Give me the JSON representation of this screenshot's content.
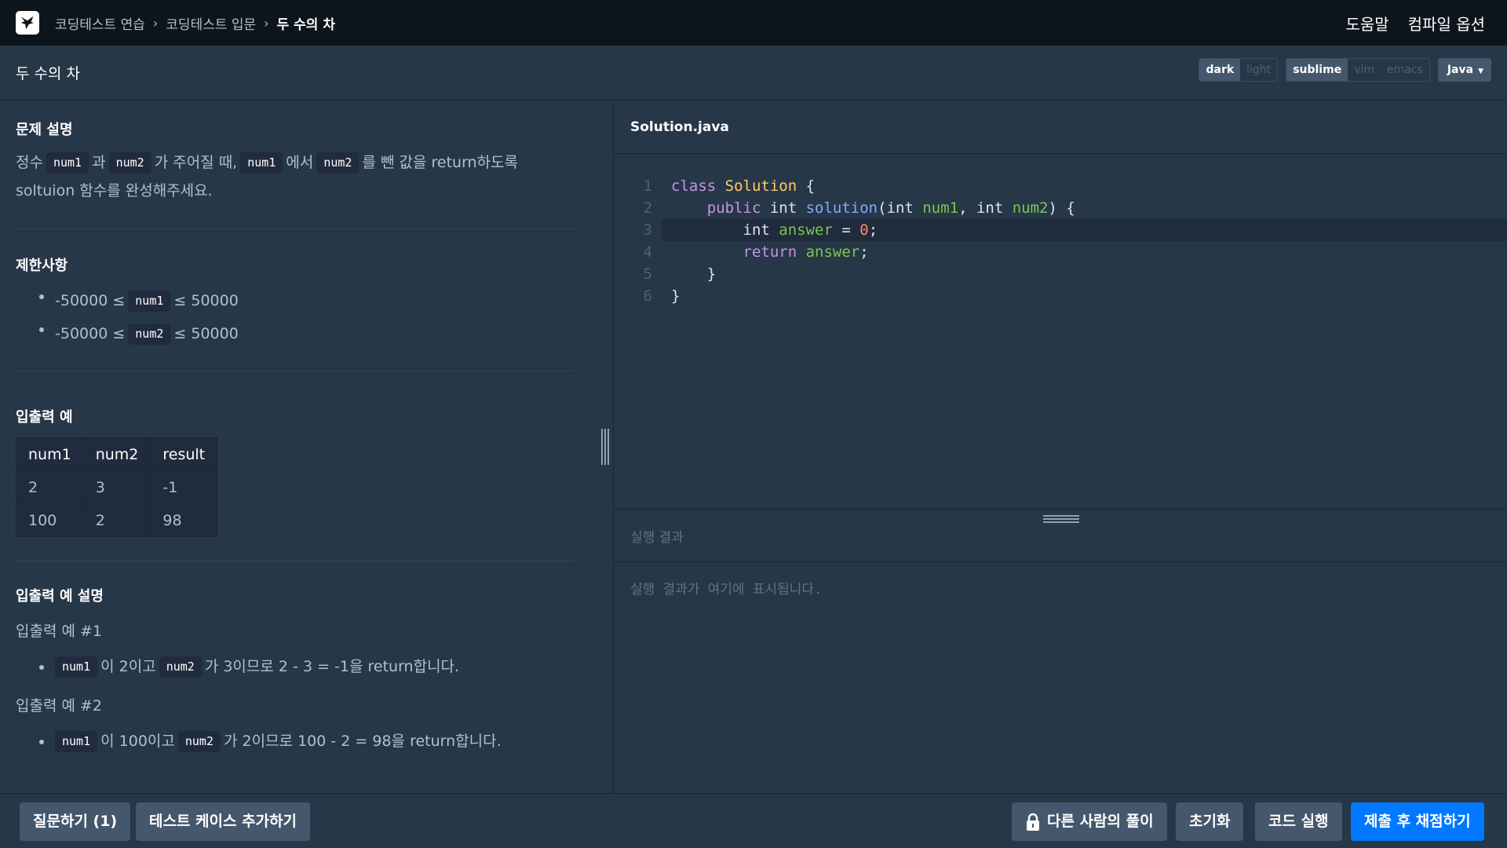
{
  "header": {
    "breadcrumb": [
      "코딩테스트 연습",
      "코딩테스트 입문",
      "두 수의 차"
    ],
    "help": "도움말",
    "compile_options": "컴파일 옵션"
  },
  "title_bar": {
    "title": "두 수의 차",
    "theme": {
      "dark": "dark",
      "light": "light",
      "selected": "dark"
    },
    "keymap": {
      "sublime": "sublime",
      "vim": "vim",
      "emacs": "emacs",
      "selected": "sublime"
    },
    "language": "Java"
  },
  "problem": {
    "desc_heading": "문제 설명",
    "desc": {
      "t1": "정수",
      "c1": "num1",
      "t2": "과",
      "c2": "num2",
      "t3": "가 주어질 때,",
      "c3": "num1",
      "t4": "에서",
      "c4": "num2",
      "t5": "를 뺀 값을 return하도록",
      "t6": "soltuion 함수를 완성해주세요."
    },
    "constraints_heading": "제한사항",
    "constraints": [
      {
        "pre": "-50000 ≤",
        "code": "num1",
        "post": "≤ 50000"
      },
      {
        "pre": "-50000 ≤",
        "code": "num2",
        "post": "≤ 50000"
      }
    ],
    "io_heading": "입출력 예",
    "io_table": {
      "headers": [
        "num1",
        "num2",
        "result"
      ],
      "rows": [
        [
          "2",
          "3",
          "-1"
        ],
        [
          "100",
          "2",
          "98"
        ]
      ]
    },
    "io_explain_heading": "입출력 예 설명",
    "examples": [
      {
        "title": "입출력 예 #1",
        "c1": "num1",
        "t1": "이 2이고",
        "c2": "num2",
        "t2": "가 3이므로 2 - 3 = -1을 return합니다."
      },
      {
        "title": "입출력 예 #2",
        "c1": "num1",
        "t1": "이 100이고",
        "c2": "num2",
        "t2": "가 2이므로 100 - 2 = 98을 return합니다."
      }
    ]
  },
  "editor": {
    "filename": "Solution.java",
    "line_numbers": [
      "1",
      "2",
      "3",
      "4",
      "5",
      "6"
    ],
    "highlighted_line": 3,
    "colors": {
      "keyword": "#c792ea",
      "class": "#ffcb6b",
      "function": "#82aaff",
      "variable": "#78c850",
      "number": "#f78c6c"
    }
  },
  "result": {
    "heading": "실행 결과",
    "placeholder": "실행 결과가 여기에 표시됩니다."
  },
  "footer": {
    "ask": "질문하기 (1)",
    "add_testcase": "테스트 케이스 추가하기",
    "others_solutions": "다른 사람의 풀이",
    "reset": "초기화",
    "run": "코드 실행",
    "submit": "제출 후 채점하기",
    "submit_color": "#0078ff"
  }
}
